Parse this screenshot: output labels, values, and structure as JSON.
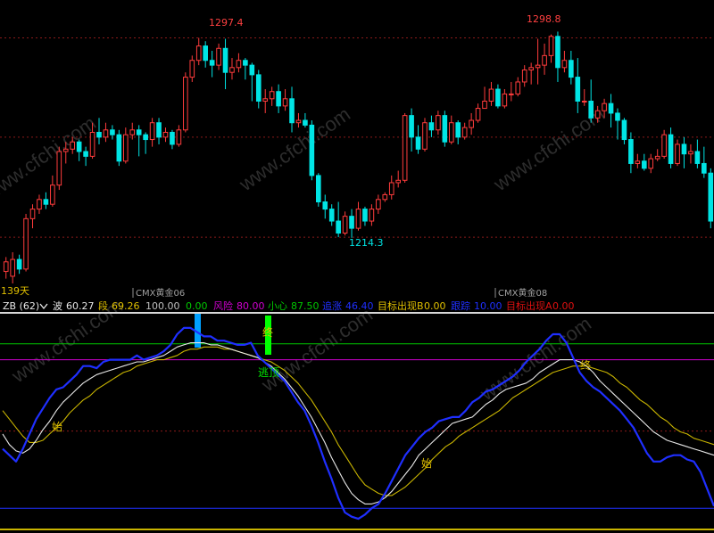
{
  "price_panel": {
    "high_label_1": "1297.4",
    "high_label_2": "1298.8",
    "low_label": "1214.3",
    "days_label": "139天",
    "contract_label_1": "CMX黄金06",
    "contract_label_2": "CMX黄金08"
  },
  "indicator_header": {
    "name": "ZB (62)",
    "bo_label": "波",
    "bo_value": "60.27",
    "duan_label": "段",
    "duan_value": "69.26",
    "v100": "100.00",
    "v0": "0.00",
    "risk_label": "风险",
    "risk_value": "80.00",
    "careful_label": "小心",
    "careful_value": "87.50",
    "chase_label": "追涨",
    "chase_value": "46.40",
    "targetB_label": "目标出现B",
    "targetB_value": "0.00",
    "follow_label": "跟踪",
    "follow_value": "10.00",
    "targetA_label": "目标出现A",
    "targetA_value": "0.00"
  },
  "annotations": {
    "start": "始",
    "end": "终",
    "escape_top": "逃顶"
  },
  "watermark": "www.cfchi.com",
  "colors": {
    "up": "#ff3c3c",
    "down": "#00e5e5",
    "blue_line": "#1f2fff",
    "white_line": "#e8e8e8",
    "yellow_line": "#c8b400",
    "green_level": "#00c800",
    "magenta_level": "#d000d0",
    "grid_red": "#8a1a1a",
    "cyan_bar": "#00a0ff",
    "green_bar": "#00ff00"
  },
  "chart_data": [
    {
      "type": "candlestick",
      "title": "",
      "ylim": [
        1195,
        1305
      ],
      "reference_levels": [
        1297.4,
        1256,
        1214.3
      ],
      "annotated": {
        "high_1": 1297.4,
        "high_2": 1298.8,
        "low": 1214.3
      },
      "candles": [
        [
          1200,
          1204,
          1197,
          1206
        ],
        [
          1198,
          1205,
          1195,
          1208
        ],
        [
          1205,
          1201,
          1199,
          1207
        ],
        [
          1201,
          1222,
          1200,
          1224
        ],
        [
          1222,
          1226,
          1218,
          1228
        ],
        [
          1226,
          1230,
          1224,
          1232
        ],
        [
          1230,
          1228,
          1226,
          1233
        ],
        [
          1228,
          1236,
          1227,
          1240
        ],
        [
          1236,
          1250,
          1234,
          1252
        ],
        [
          1250,
          1251,
          1245,
          1254
        ],
        [
          1251,
          1254,
          1249,
          1256
        ],
        [
          1254,
          1250,
          1246,
          1255
        ],
        [
          1250,
          1248,
          1244,
          1252
        ],
        [
          1248,
          1258,
          1247,
          1262
        ],
        [
          1258,
          1256,
          1253,
          1264
        ],
        [
          1256,
          1259,
          1254,
          1262
        ],
        [
          1259,
          1257,
          1255,
          1261
        ],
        [
          1257,
          1246,
          1244,
          1259
        ],
        [
          1246,
          1257,
          1245,
          1260
        ],
        [
          1257,
          1259,
          1255,
          1262
        ],
        [
          1259,
          1257,
          1248,
          1261
        ],
        [
          1257,
          1255,
          1249,
          1258
        ],
        [
          1255,
          1262,
          1252,
          1264
        ],
        [
          1262,
          1256,
          1253,
          1264
        ],
        [
          1256,
          1258,
          1254,
          1260
        ],
        [
          1258,
          1253,
          1251,
          1259
        ],
        [
          1253,
          1259,
          1252,
          1261
        ],
        [
          1259,
          1281,
          1258,
          1283
        ],
        [
          1281,
          1288,
          1279,
          1290
        ],
        [
          1288,
          1294,
          1286,
          1297.4
        ],
        [
          1294,
          1288,
          1285,
          1296
        ],
        [
          1288,
          1286,
          1281,
          1292
        ],
        [
          1286,
          1293,
          1284,
          1295
        ],
        [
          1293,
          1283,
          1276,
          1297
        ],
        [
          1283,
          1285,
          1280,
          1289
        ],
        [
          1285,
          1288,
          1283,
          1291
        ],
        [
          1288,
          1286,
          1280,
          1289
        ],
        [
          1286,
          1282,
          1271,
          1287
        ],
        [
          1282,
          1271,
          1268,
          1284
        ],
        [
          1271,
          1272,
          1266,
          1276
        ],
        [
          1272,
          1275,
          1269,
          1277
        ],
        [
          1275,
          1269,
          1266,
          1278
        ],
        [
          1269,
          1272,
          1267,
          1276
        ],
        [
          1272,
          1262,
          1258,
          1277
        ],
        [
          1262,
          1263,
          1260,
          1266
        ],
        [
          1263,
          1261,
          1260,
          1266
        ],
        [
          1261,
          1240,
          1238,
          1263
        ],
        [
          1240,
          1229,
          1227,
          1241
        ],
        [
          1229,
          1226,
          1222,
          1232
        ],
        [
          1226,
          1221,
          1219,
          1228
        ],
        [
          1221,
          1216,
          1214.3,
          1229
        ],
        [
          1216,
          1223,
          1215,
          1225
        ],
        [
          1223,
          1218,
          1214,
          1226
        ],
        [
          1218,
          1226,
          1217,
          1229
        ],
        [
          1226,
          1221,
          1219,
          1227
        ],
        [
          1221,
          1226,
          1219,
          1228
        ],
        [
          1226,
          1230,
          1224,
          1232
        ],
        [
          1230,
          1232,
          1229,
          1233
        ],
        [
          1232,
          1237,
          1230,
          1240
        ],
        [
          1237,
          1238,
          1235,
          1242
        ],
        [
          1238,
          1265,
          1237,
          1266
        ],
        [
          1265,
          1256,
          1250,
          1268
        ],
        [
          1256,
          1251,
          1249,
          1261
        ],
        [
          1251,
          1262,
          1250,
          1264
        ],
        [
          1262,
          1259,
          1256,
          1265
        ],
        [
          1259,
          1265,
          1257,
          1267
        ],
        [
          1265,
          1254,
          1252,
          1267
        ],
        [
          1254,
          1262,
          1253,
          1265
        ],
        [
          1262,
          1256,
          1253,
          1263
        ],
        [
          1256,
          1260,
          1255,
          1262
        ],
        [
          1260,
          1263,
          1257,
          1266
        ],
        [
          1263,
          1268,
          1262,
          1270
        ],
        [
          1268,
          1271,
          1268,
          1277
        ],
        [
          1271,
          1276,
          1269,
          1279
        ],
        [
          1276,
          1269,
          1268,
          1278
        ],
        [
          1269,
          1274,
          1268,
          1276
        ],
        [
          1274,
          1274,
          1271,
          1279
        ],
        [
          1274,
          1279,
          1273,
          1281
        ],
        [
          1279,
          1284,
          1277,
          1286
        ],
        [
          1284,
          1285,
          1278,
          1287
        ],
        [
          1285,
          1286,
          1278,
          1297
        ],
        [
          1286,
          1290,
          1282,
          1295
        ],
        [
          1290,
          1298,
          1287,
          1298.8
        ],
        [
          1298,
          1285,
          1279,
          1300
        ],
        [
          1285,
          1288,
          1283,
          1292
        ],
        [
          1288,
          1281,
          1278,
          1292
        ],
        [
          1281,
          1271,
          1266,
          1289
        ],
        [
          1271,
          1271,
          1269,
          1276
        ],
        [
          1271,
          1264,
          1262,
          1280
        ],
        [
          1264,
          1267,
          1262,
          1269
        ],
        [
          1267,
          1270,
          1264,
          1272
        ],
        [
          1270,
          1266,
          1260,
          1274
        ],
        [
          1266,
          1263,
          1255,
          1268
        ],
        [
          1263,
          1255,
          1253,
          1264
        ],
        [
          1255,
          1245,
          1241,
          1258
        ],
        [
          1245,
          1246,
          1243,
          1249
        ],
        [
          1246,
          1243,
          1242,
          1249
        ],
        [
          1243,
          1247,
          1241,
          1249
        ],
        [
          1247,
          1248,
          1246,
          1251
        ],
        [
          1248,
          1257,
          1247,
          1259
        ],
        [
          1257,
          1245,
          1243,
          1260
        ],
        [
          1245,
          1253,
          1244,
          1255
        ],
        [
          1253,
          1249,
          1243,
          1256
        ],
        [
          1249,
          1250,
          1245,
          1253
        ],
        [
          1250,
          1245,
          1243,
          1255
        ],
        [
          1245,
          1241,
          1239,
          1252
        ],
        [
          1241,
          1221,
          1218,
          1243
        ]
      ]
    },
    {
      "type": "line",
      "title": "ZB (62)",
      "ylim": [
        0,
        100
      ],
      "levels": {
        "risk": 80.0,
        "careful": 87.5,
        "chase": 46.4,
        "follow": 10.0,
        "top": 100.0,
        "zero": 0.0
      },
      "latest": {
        "bo": 60.27,
        "duan": 69.26
      },
      "series": [
        {
          "name": "波",
          "color_key": "blue_line",
          "values": [
            38,
            35,
            32,
            38,
            45,
            52,
            57,
            62,
            66,
            67,
            70,
            73,
            77,
            77,
            76,
            79,
            80,
            80,
            80,
            80,
            82,
            80,
            81,
            82,
            84,
            87,
            92,
            95,
            95,
            93,
            91,
            91,
            89,
            89,
            88,
            87,
            87,
            88,
            82,
            79,
            76,
            73,
            70,
            65,
            60,
            56,
            49,
            41,
            32,
            24,
            15,
            8,
            6,
            5,
            7,
            10,
            12,
            17,
            23,
            29,
            35,
            39,
            43,
            46,
            48,
            51,
            52,
            53,
            53,
            56,
            60,
            62,
            65,
            66,
            68,
            70,
            72,
            75,
            79,
            82,
            85,
            89,
            92,
            92,
            88,
            81,
            74,
            70,
            67,
            65,
            62,
            59,
            56,
            52,
            48,
            42,
            36,
            32,
            32,
            34,
            35,
            35,
            33,
            32,
            27,
            19,
            11
          ]
        },
        {
          "name": "段",
          "color_key": "white_line",
          "values": [
            45,
            40,
            37,
            36,
            38,
            42,
            47,
            51,
            56,
            60,
            63,
            66,
            69,
            71,
            73,
            74,
            75,
            76,
            77,
            78,
            79,
            79,
            80,
            81,
            82,
            84,
            86,
            87,
            88,
            88,
            88,
            87,
            87,
            86,
            85,
            84,
            83,
            82,
            81,
            79,
            77,
            74,
            71,
            67,
            63,
            58,
            53,
            47,
            41,
            34,
            28,
            22,
            17,
            14,
            12,
            12,
            13,
            15,
            18,
            22,
            26,
            30,
            35,
            38,
            41,
            44,
            47,
            50,
            51,
            52,
            53,
            56,
            59,
            61,
            64,
            66,
            67,
            68,
            69,
            71,
            74,
            76,
            78,
            80,
            80,
            80,
            79,
            77,
            74,
            70,
            67,
            64,
            61,
            58,
            55,
            52,
            49,
            46,
            44,
            42,
            41,
            40,
            39,
            38,
            37,
            36,
            35
          ]
        },
        {
          "name": "",
          "color_key": "yellow_line",
          "values": [
            56,
            52,
            48,
            44,
            41,
            41,
            42,
            45,
            48,
            51,
            55,
            58,
            61,
            63,
            66,
            68,
            70,
            72,
            74,
            75,
            77,
            78,
            79,
            80,
            80,
            81,
            82,
            84,
            85,
            85,
            86,
            86,
            86,
            85,
            85,
            84,
            83,
            82,
            81,
            80,
            79,
            77,
            75,
            72,
            69,
            65,
            61,
            56,
            51,
            46,
            40,
            35,
            30,
            25,
            21,
            19,
            17,
            16,
            16,
            18,
            20,
            23,
            26,
            29,
            33,
            36,
            39,
            41,
            44,
            46,
            48,
            50,
            52,
            54,
            56,
            59,
            62,
            64,
            66,
            68,
            70,
            72,
            74,
            75,
            76,
            77,
            77,
            77,
            76,
            75,
            74,
            72,
            69,
            67,
            64,
            61,
            59,
            56,
            53,
            51,
            48,
            46,
            45,
            43,
            42,
            41,
            40
          ]
        }
      ]
    }
  ]
}
